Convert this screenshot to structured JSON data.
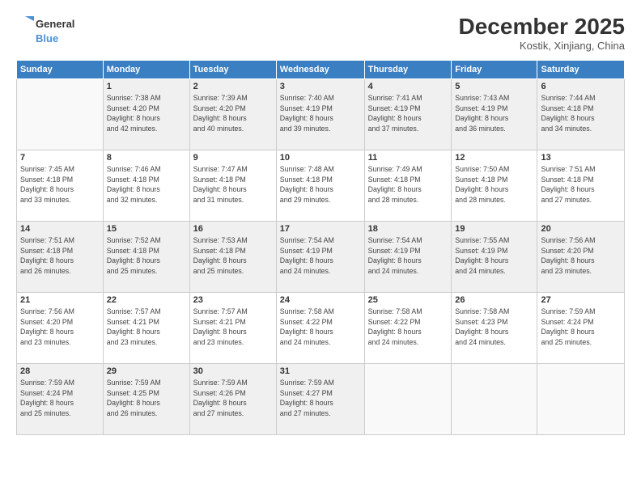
{
  "header": {
    "logo_line1": "General",
    "logo_line2": "Blue",
    "month_title": "December 2025",
    "subtitle": "Kostik, Xinjiang, China"
  },
  "weekdays": [
    "Sunday",
    "Monday",
    "Tuesday",
    "Wednesday",
    "Thursday",
    "Friday",
    "Saturday"
  ],
  "weeks": [
    [
      {
        "day": "",
        "info": ""
      },
      {
        "day": "1",
        "info": "Sunrise: 7:38 AM\nSunset: 4:20 PM\nDaylight: 8 hours\nand 42 minutes."
      },
      {
        "day": "2",
        "info": "Sunrise: 7:39 AM\nSunset: 4:20 PM\nDaylight: 8 hours\nand 40 minutes."
      },
      {
        "day": "3",
        "info": "Sunrise: 7:40 AM\nSunset: 4:19 PM\nDaylight: 8 hours\nand 39 minutes."
      },
      {
        "day": "4",
        "info": "Sunrise: 7:41 AM\nSunset: 4:19 PM\nDaylight: 8 hours\nand 37 minutes."
      },
      {
        "day": "5",
        "info": "Sunrise: 7:43 AM\nSunset: 4:19 PM\nDaylight: 8 hours\nand 36 minutes."
      },
      {
        "day": "6",
        "info": "Sunrise: 7:44 AM\nSunset: 4:18 PM\nDaylight: 8 hours\nand 34 minutes."
      }
    ],
    [
      {
        "day": "7",
        "info": "Sunrise: 7:45 AM\nSunset: 4:18 PM\nDaylight: 8 hours\nand 33 minutes."
      },
      {
        "day": "8",
        "info": "Sunrise: 7:46 AM\nSunset: 4:18 PM\nDaylight: 8 hours\nand 32 minutes."
      },
      {
        "day": "9",
        "info": "Sunrise: 7:47 AM\nSunset: 4:18 PM\nDaylight: 8 hours\nand 31 minutes."
      },
      {
        "day": "10",
        "info": "Sunrise: 7:48 AM\nSunset: 4:18 PM\nDaylight: 8 hours\nand 29 minutes."
      },
      {
        "day": "11",
        "info": "Sunrise: 7:49 AM\nSunset: 4:18 PM\nDaylight: 8 hours\nand 28 minutes."
      },
      {
        "day": "12",
        "info": "Sunrise: 7:50 AM\nSunset: 4:18 PM\nDaylight: 8 hours\nand 28 minutes."
      },
      {
        "day": "13",
        "info": "Sunrise: 7:51 AM\nSunset: 4:18 PM\nDaylight: 8 hours\nand 27 minutes."
      }
    ],
    [
      {
        "day": "14",
        "info": "Sunrise: 7:51 AM\nSunset: 4:18 PM\nDaylight: 8 hours\nand 26 minutes."
      },
      {
        "day": "15",
        "info": "Sunrise: 7:52 AM\nSunset: 4:18 PM\nDaylight: 8 hours\nand 25 minutes."
      },
      {
        "day": "16",
        "info": "Sunrise: 7:53 AM\nSunset: 4:18 PM\nDaylight: 8 hours\nand 25 minutes."
      },
      {
        "day": "17",
        "info": "Sunrise: 7:54 AM\nSunset: 4:19 PM\nDaylight: 8 hours\nand 24 minutes."
      },
      {
        "day": "18",
        "info": "Sunrise: 7:54 AM\nSunset: 4:19 PM\nDaylight: 8 hours\nand 24 minutes."
      },
      {
        "day": "19",
        "info": "Sunrise: 7:55 AM\nSunset: 4:19 PM\nDaylight: 8 hours\nand 24 minutes."
      },
      {
        "day": "20",
        "info": "Sunrise: 7:56 AM\nSunset: 4:20 PM\nDaylight: 8 hours\nand 23 minutes."
      }
    ],
    [
      {
        "day": "21",
        "info": "Sunrise: 7:56 AM\nSunset: 4:20 PM\nDaylight: 8 hours\nand 23 minutes."
      },
      {
        "day": "22",
        "info": "Sunrise: 7:57 AM\nSunset: 4:21 PM\nDaylight: 8 hours\nand 23 minutes."
      },
      {
        "day": "23",
        "info": "Sunrise: 7:57 AM\nSunset: 4:21 PM\nDaylight: 8 hours\nand 23 minutes."
      },
      {
        "day": "24",
        "info": "Sunrise: 7:58 AM\nSunset: 4:22 PM\nDaylight: 8 hours\nand 24 minutes."
      },
      {
        "day": "25",
        "info": "Sunrise: 7:58 AM\nSunset: 4:22 PM\nDaylight: 8 hours\nand 24 minutes."
      },
      {
        "day": "26",
        "info": "Sunrise: 7:58 AM\nSunset: 4:23 PM\nDaylight: 8 hours\nand 24 minutes."
      },
      {
        "day": "27",
        "info": "Sunrise: 7:59 AM\nSunset: 4:24 PM\nDaylight: 8 hours\nand 25 minutes."
      }
    ],
    [
      {
        "day": "28",
        "info": "Sunrise: 7:59 AM\nSunset: 4:24 PM\nDaylight: 8 hours\nand 25 minutes."
      },
      {
        "day": "29",
        "info": "Sunrise: 7:59 AM\nSunset: 4:25 PM\nDaylight: 8 hours\nand 26 minutes."
      },
      {
        "day": "30",
        "info": "Sunrise: 7:59 AM\nSunset: 4:26 PM\nDaylight: 8 hours\nand 27 minutes."
      },
      {
        "day": "31",
        "info": "Sunrise: 7:59 AM\nSunset: 4:27 PM\nDaylight: 8 hours\nand 27 minutes."
      },
      {
        "day": "",
        "info": ""
      },
      {
        "day": "",
        "info": ""
      },
      {
        "day": "",
        "info": ""
      }
    ]
  ]
}
